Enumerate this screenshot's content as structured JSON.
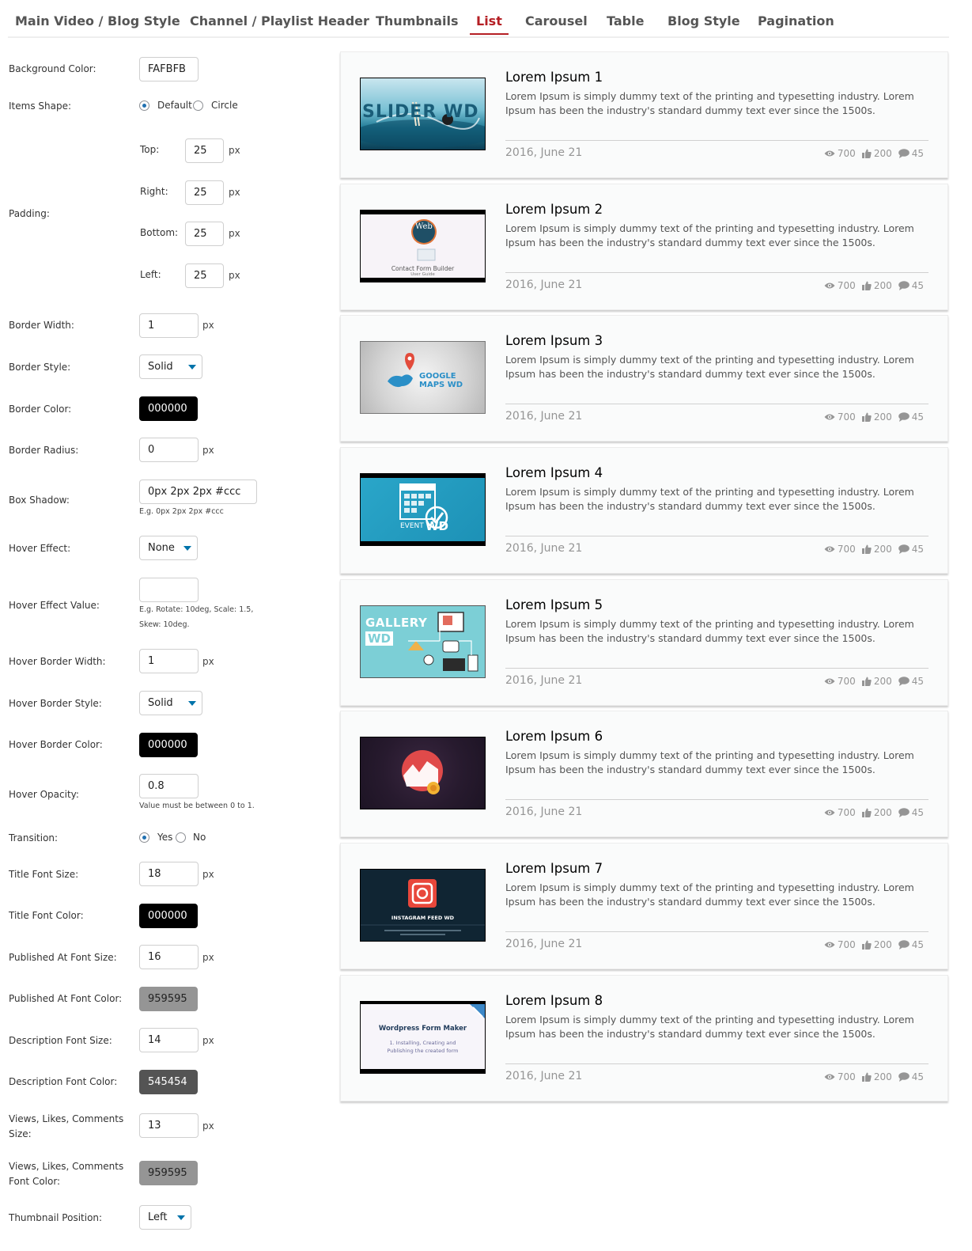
{
  "tabs": [
    {
      "label": "Main Video / Blog Style"
    },
    {
      "label": "Channel / Playlist Header"
    },
    {
      "label": "Thumbnails"
    },
    {
      "label": "List"
    },
    {
      "label": "Carousel"
    },
    {
      "label": "Table"
    },
    {
      "label": "Blog Style"
    },
    {
      "label": "Pagination"
    }
  ],
  "settings": {
    "background_color": {
      "label": "Background Color:",
      "value": "FAFBFB"
    },
    "items_shape": {
      "label": "Items Shape:",
      "option_default": "Default",
      "option_circle": "Circle",
      "selected": "Default"
    },
    "padding": {
      "label": "Padding:",
      "top_label": "Top:",
      "top": "25",
      "right_label": "Right:",
      "right": "25",
      "bottom_label": "Bottom:",
      "bottom": "25",
      "left_label": "Left:",
      "left": "25",
      "unit": "px"
    },
    "border_width": {
      "label": "Border Width:",
      "value": "1",
      "unit": "px"
    },
    "border_style": {
      "label": "Border Style:",
      "value": "Solid"
    },
    "border_color": {
      "label": "Border Color:",
      "value": "000000"
    },
    "border_radius": {
      "label": "Border Radius:",
      "value": "0",
      "unit": "px"
    },
    "box_shadow": {
      "label": "Box Shadow:",
      "value": "0px 2px 2px #ccc",
      "hint": "E.g. 0px 2px 2px #ccc"
    },
    "hover_effect": {
      "label": "Hover Effect:",
      "value": "None"
    },
    "hover_effect_value": {
      "label": "Hover Effect Value:",
      "value": "",
      "hint_line1": "E.g. Rotate: 10deg, Scale: 1.5,",
      "hint_line2": "Skew: 10deg."
    },
    "hover_border_width": {
      "label": "Hover Border Width:",
      "value": "1",
      "unit": "px"
    },
    "hover_border_style": {
      "label": "Hover Border Style:",
      "value": "Solid"
    },
    "hover_border_color": {
      "label": "Hover Border Color:",
      "value": "000000"
    },
    "hover_opacity": {
      "label": "Hover Opacity:",
      "value": "0.8",
      "hint": "Value must be between 0 to 1."
    },
    "transition": {
      "label": "Transition:",
      "option_yes": "Yes",
      "option_no": "No",
      "selected": "Yes"
    },
    "title_font_size": {
      "label": "Title Font Size:",
      "value": "18",
      "unit": "px"
    },
    "title_font_color": {
      "label": "Title Font Color:",
      "value": "000000"
    },
    "published_font_size": {
      "label": "Published At Font Size:",
      "value": "16",
      "unit": "px"
    },
    "published_font_color": {
      "label": "Published At Font Color:",
      "value": "959595"
    },
    "description_font_size": {
      "label": "Description Font Size:",
      "value": "14",
      "unit": "px"
    },
    "description_font_color": {
      "label": "Description Font Color:",
      "value": "545454"
    },
    "stats_size": {
      "label": "Views, Likes, Comments Size:",
      "value": "13",
      "unit": "px"
    },
    "stats_font_color": {
      "label": "Views, Likes, Comments Font Color:",
      "value": "959595"
    },
    "thumbnail_position": {
      "label": "Thumbnail Position:",
      "value": "Left"
    }
  },
  "items": [
    {
      "title": "Lorem Ipsum 1",
      "description": "Lorem Ipsum is simply dummy text of the printing and typesetting industry. Lorem Ipsum has been the industry's standard dummy text ever since the 1500s.",
      "date": "2016, June 21",
      "views": "700",
      "likes": "200",
      "comments": "45",
      "thumb_text": "SLIDER WD"
    },
    {
      "title": "Lorem Ipsum 2",
      "description": "Lorem Ipsum is simply dummy text of the printing and typesetting industry. Lorem Ipsum has been the industry's standard dummy text ever since the 1500s.",
      "date": "2016, June 21",
      "views": "700",
      "likes": "200",
      "comments": "45",
      "thumb_text": "Contact Form Builder",
      "thumb_sub": "User Guide",
      "thumb_logo": "Web"
    },
    {
      "title": "Lorem Ipsum 3",
      "description": "Lorem Ipsum is simply dummy text of the printing and typesetting industry. Lorem Ipsum has been the industry's standard dummy text ever since the 1500s.",
      "date": "2016, June 21",
      "views": "700",
      "likes": "200",
      "comments": "45",
      "thumb_text": "GOOGLE",
      "thumb_sub": "MAPS WD"
    },
    {
      "title": "Lorem Ipsum 4",
      "description": "Lorem Ipsum is simply dummy text of the printing and typesetting industry. Lorem Ipsum has been the industry's standard dummy text ever since the 1500s.",
      "date": "2016, June 21",
      "views": "700",
      "likes": "200",
      "comments": "45",
      "thumb_text": "EVENT",
      "thumb_sub": "WD"
    },
    {
      "title": "Lorem Ipsum 5",
      "description": "Lorem Ipsum is simply dummy text of the printing and typesetting industry. Lorem Ipsum has been the industry's standard dummy text ever since the 1500s.",
      "date": "2016, June 21",
      "views": "700",
      "likes": "200",
      "comments": "45",
      "thumb_text": "GALLERY",
      "thumb_sub": "WD"
    },
    {
      "title": "Lorem Ipsum 6",
      "description": "Lorem Ipsum is simply dummy text of the printing and typesetting industry. Lorem Ipsum has been the industry's standard dummy text ever since the 1500s.",
      "date": "2016, June 21",
      "views": "700",
      "likes": "200",
      "comments": "45"
    },
    {
      "title": "Lorem Ipsum 7",
      "description": "Lorem Ipsum is simply dummy text of the printing and typesetting industry. Lorem Ipsum has been the industry's standard dummy text ever since the 1500s.",
      "date": "2016, June 21",
      "views": "700",
      "likes": "200",
      "comments": "45",
      "thumb_text": "INSTAGRAM FEED WD"
    },
    {
      "title": "Lorem Ipsum 8",
      "description": "Lorem Ipsum is simply dummy text of the printing and typesetting industry. Lorem Ipsum has been the industry's standard dummy text ever since the 1500s.",
      "date": "2016, June 21",
      "views": "700",
      "likes": "200",
      "comments": "45",
      "thumb_text": "Wordpress Form Maker",
      "thumb_sub": "1. Installing, Creating and Publishing the created form"
    }
  ],
  "colors": {
    "accent": "#b51f24",
    "radio": "#2271b1",
    "select_caret": "#0073aa",
    "card_bg": "#FAFBFB"
  },
  "icons": {
    "views": "eye-icon",
    "likes": "thumbs-up-icon",
    "comments": "comment-icon"
  }
}
